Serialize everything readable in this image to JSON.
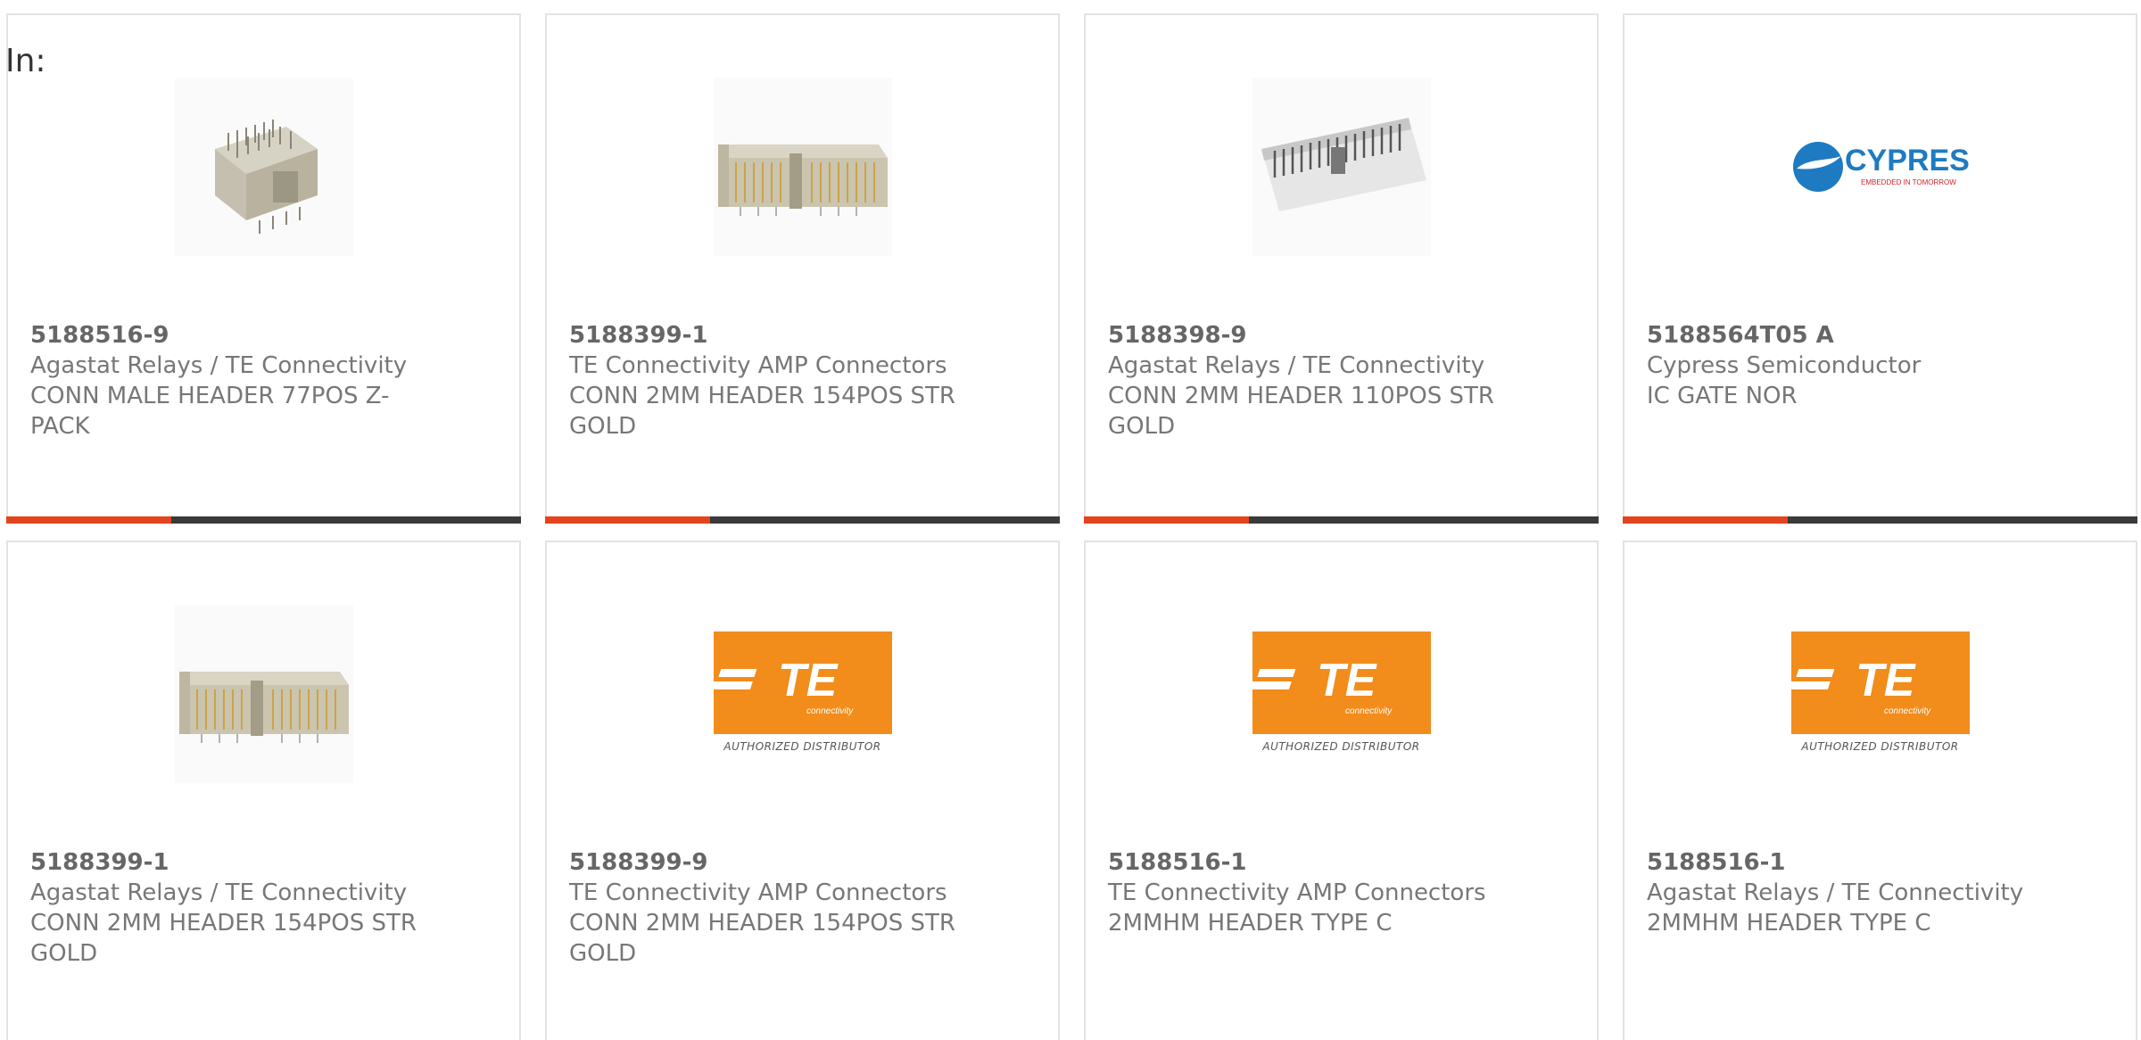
{
  "filter_label": "In:",
  "colors": {
    "accent": "#e5431c",
    "bar_dark": "#3a3a3a",
    "te_orange": "#f28c1b",
    "cypress_blue": "#1e7bc1",
    "cypress_red": "#d2232a"
  },
  "logos": {
    "te_text": "TE",
    "te_sub": "connectivity",
    "te_authorized": "AUTHORIZED DISTRIBUTOR",
    "cypress_text": "CYPRESS",
    "cypress_sub": "EMBEDDED IN TOMORROW"
  },
  "products": [
    {
      "part_number": "5188516-9",
      "manufacturer": "Agastat Relays / TE Connectivity",
      "description": "CONN MALE HEADER 77POS Z-PACK",
      "image": "connector-zpack-icon"
    },
    {
      "part_number": "5188399-1",
      "manufacturer": "TE Connectivity AMP Connectors",
      "description": "CONN 2MM HEADER 154POS STR GOLD",
      "image": "connector-header-gold-icon"
    },
    {
      "part_number": "5188398-9",
      "manufacturer": "Agastat Relays / TE Connectivity",
      "description": "CONN 2MM HEADER 110POS STR GOLD",
      "image": "connector-header-white-icon"
    },
    {
      "part_number": "5188564T05 A",
      "manufacturer": "Cypress Semiconductor",
      "description": "IC GATE NOR",
      "image": "cypress-logo"
    },
    {
      "part_number": "5188399-1",
      "manufacturer": "Agastat Relays / TE Connectivity",
      "description": "CONN 2MM HEADER 154POS STR GOLD",
      "image": "connector-header-gold-icon"
    },
    {
      "part_number": "5188399-9",
      "manufacturer": "TE Connectivity AMP Connectors",
      "description": "CONN 2MM HEADER 154POS STR GOLD",
      "image": "te-connectivity-logo"
    },
    {
      "part_number": "5188516-1",
      "manufacturer": "TE Connectivity AMP Connectors",
      "description": "2MMHM HEADER TYPE C",
      "image": "te-connectivity-logo"
    },
    {
      "part_number": "5188516-1",
      "manufacturer": "Agastat Relays / TE Connectivity",
      "description": "2MMHM HEADER TYPE C",
      "image": "te-connectivity-logo"
    }
  ]
}
